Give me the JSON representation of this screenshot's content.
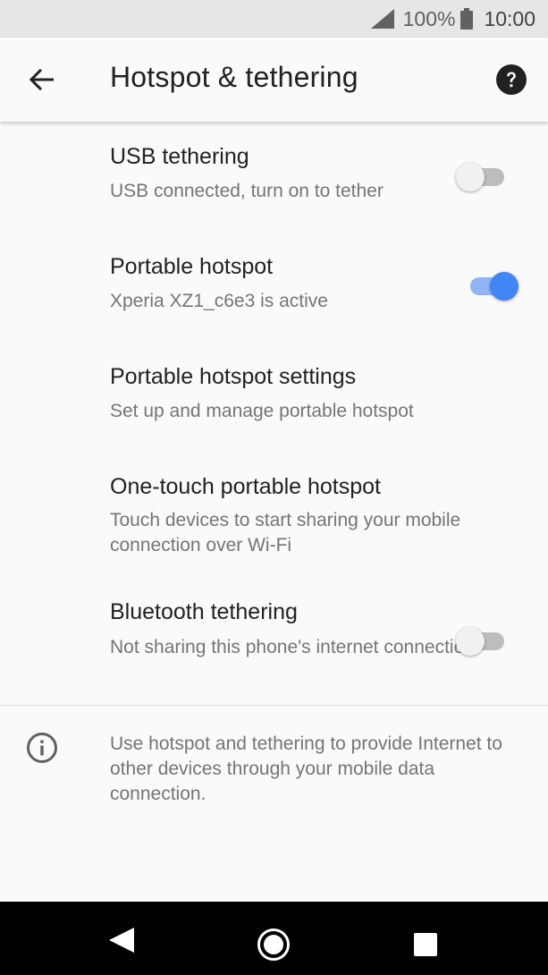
{
  "status_bar": {
    "battery_percent": "100%",
    "time": "10:00"
  },
  "app_bar": {
    "title": "Hotspot & tethering",
    "back_icon": "arrow-back-icon",
    "help_icon": "help-icon"
  },
  "items": [
    {
      "title": "USB tethering",
      "subtitle": "USB connected, turn on to tether",
      "switch": "off"
    },
    {
      "title": "Portable hotspot",
      "subtitle": "Xperia XZ1_c6e3 is active",
      "switch": "on"
    },
    {
      "title": "Portable hotspot settings",
      "subtitle": "Set up and manage portable hotspot"
    },
    {
      "title": "One-touch portable hotspot",
      "subtitle": "Touch devices to start sharing your mobile connection over Wi-Fi"
    },
    {
      "title": "Bluetooth tethering",
      "subtitle": "Not sharing this phone's internet connection",
      "switch": "off"
    }
  ],
  "footer_info": {
    "icon": "info-icon",
    "text": "Use hotspot and tethering to provide Internet to other devices through your mobile data connection."
  },
  "nav_bar": {
    "back_icon": "nav-back-icon",
    "home_icon": "nav-home-icon",
    "recents_icon": "nav-recents-icon"
  },
  "colors": {
    "accent": "#4285f4",
    "background": "#fafafa"
  }
}
